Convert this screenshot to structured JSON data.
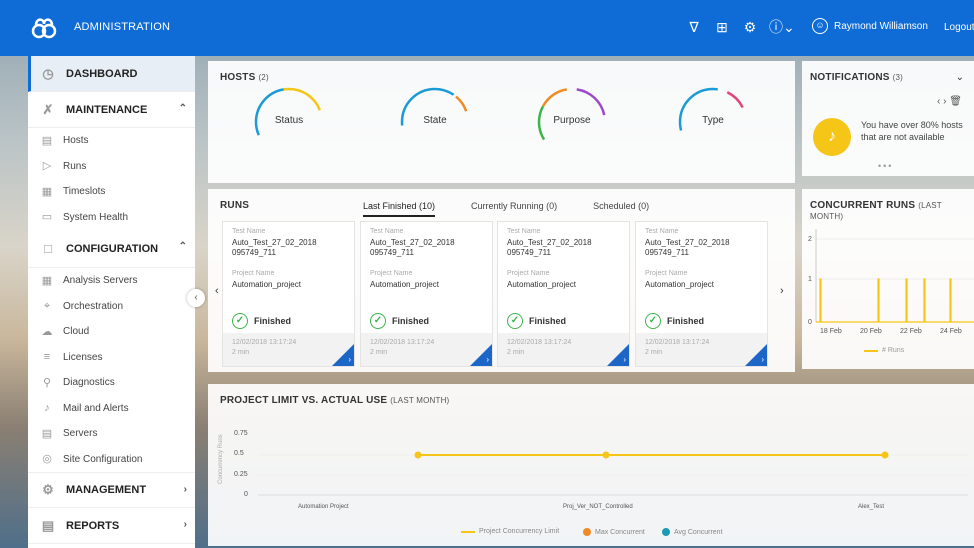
{
  "app": {
    "title": "ADMINISTRATION",
    "user_name": "Raymond Williamson",
    "logout_label": "Logout"
  },
  "topbar": {
    "icons": [
      "filter-icon",
      "export-icon",
      "settings-icon",
      "help-icon"
    ]
  },
  "sidebar": {
    "dashboard": "DASHBOARD",
    "maintenance": {
      "label": "MAINTENANCE",
      "items": [
        "Hosts",
        "Runs",
        "Timeslots",
        "System Health"
      ]
    },
    "configuration": {
      "label": "CONFIGURATION",
      "items": [
        "Analysis Servers",
        "Orchestration",
        "Cloud",
        "Licenses",
        "Diagnostics",
        "Mail and Alerts",
        "Servers",
        "Site Configuration"
      ]
    },
    "management": "MANAGEMENT",
    "reports": "REPORTS"
  },
  "hosts": {
    "title": "HOSTS",
    "count": "(2)",
    "gauges": [
      "Status",
      "State",
      "Purpose",
      "Type"
    ]
  },
  "notifications": {
    "title": "NOTIFICATIONS",
    "count": "(3)",
    "message": "You have over 80% hosts that are not available"
  },
  "runs": {
    "title": "RUNS",
    "tabs": [
      "Last Finished (10)",
      "Currently Running (0)",
      "Scheduled (0)"
    ],
    "test_name_label": "Test Name",
    "project_name_label": "Project Name",
    "cards": [
      {
        "test": "Auto_Test_27_02_2018 095749_711",
        "project": "Automation_project",
        "status": "Finished",
        "time": "12/02/2018 13:17:24",
        "duration": "2 min"
      },
      {
        "test": "Auto_Test_27_02_2018 095749_711",
        "project": "Automation_project",
        "status": "Finished",
        "time": "12/02/2018 13:17:24",
        "duration": "2 min"
      },
      {
        "test": "Auto_Test_27_02_2018 095749_711",
        "project": "Automation_project",
        "status": "Finished",
        "time": "12/02/2018 13:17:24",
        "duration": "2 min"
      },
      {
        "test": "Auto_Test_27_02_2018 095749_711",
        "project": "Automation_project",
        "status": "Finished",
        "time": "12/02/2018 13:17:24",
        "duration": "2 min"
      }
    ]
  },
  "concurrent_runs": {
    "title": "CONCURRENT RUNS",
    "subtitle": "(LAST MONTH)",
    "y_ticks": [
      "2",
      "1",
      "0"
    ],
    "x_ticks": [
      "18 Feb",
      "20 Feb",
      "22 Feb",
      "24 Feb"
    ],
    "legend": "# Runs",
    "color": "#f5c518"
  },
  "project_limit": {
    "title": "PROJECT LIMIT VS. ACTUAL USE",
    "subtitle": "(LAST MONTH)",
    "y_axis_label": "Concurrency Runs",
    "y_ticks": [
      "0.75",
      "0.5",
      "0.25",
      "0"
    ],
    "categories": [
      "Automation Project",
      "Proj_Ver_NOT_Controlled",
      "Alex_Test"
    ],
    "legend": [
      "Project Concurrency Limit",
      "Max Concurrent",
      "Avg Concurrent"
    ],
    "colors": [
      "#f5c518",
      "#f08a24",
      "#1a9ab3"
    ],
    "values": [
      0.5,
      0.5,
      0.5
    ]
  }
}
